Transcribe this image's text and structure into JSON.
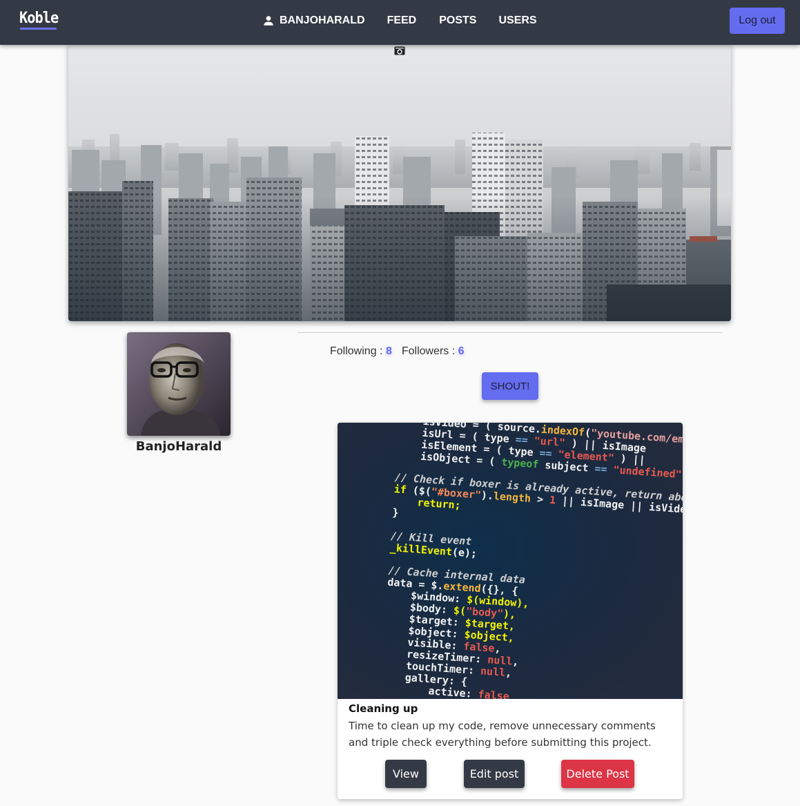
{
  "app": {
    "logo": "Koble"
  },
  "nav": {
    "user_label": "BANJOHARALD",
    "feed_label": "FEED",
    "posts_label": "POSTS",
    "users_label": "USERS",
    "logout_label": "Log out"
  },
  "profile": {
    "username": "BanjoHarald",
    "following_label": "Following :",
    "following_count": "8",
    "followers_label": "Followers :",
    "followers_count": "6",
    "shout_label": "SHOUT!"
  },
  "post": {
    "title": "Cleaning up",
    "body": "Time to clean up my code, remove unnecessary comments and triple check everything before submitting this project.",
    "view_label": "View",
    "edit_label": "Edit post",
    "delete_label": "Delete Post"
  },
  "colors": {
    "navbar": "#343a45",
    "accent": "#646cf0",
    "danger": "#dc3545",
    "background": "#fafafa"
  },
  "icons": [
    "user-icon",
    "camera-icon"
  ]
}
